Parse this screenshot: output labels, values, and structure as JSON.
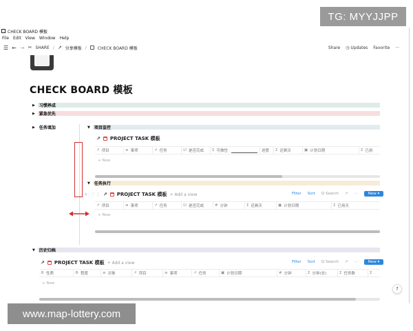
{
  "watermarks": {
    "tg": "TG: MYYJJPP",
    "url": "www.map-lottery.com"
  },
  "window": {
    "title": "CHECK BOARD 模板"
  },
  "menu": [
    "File",
    "Edit",
    "View",
    "Window",
    "Help"
  ],
  "breadcrumbs": [
    "SHARE",
    "分享模板",
    "CHECK BOARD 模板"
  ],
  "topbar": {
    "share": "Share",
    "updates": "Updates",
    "favorite": "Favorite",
    "more": "···"
  },
  "page": {
    "title": "CHECK BOARD 模板"
  },
  "toggles": [
    {
      "label": "习惯养成",
      "color": "#dfece6"
    },
    {
      "label": "紧急优先",
      "color": "#f7dede"
    },
    {
      "label": "任务填加"
    }
  ],
  "sections": {
    "monitor": {
      "label": "项目监控",
      "color": "#e3ebee"
    },
    "execute": {
      "label": "任务执行",
      "color": "#f6ecd9"
    },
    "history": {
      "label": "历史归档",
      "color": "#e7e6ef"
    }
  },
  "db1": {
    "title": "PROJECT TASK 模板",
    "columns": [
      {
        "glyph": "↗",
        "label": "项目"
      },
      {
        "glyph": "≡",
        "label": "事项"
      },
      {
        "glyph": "↗",
        "label": "任务"
      },
      {
        "glyph": "☑",
        "label": "是否完成"
      },
      {
        "glyph": "Σ",
        "label": "可做性"
      },
      {
        "glyph": "",
        "label": "进度"
      },
      {
        "glyph": "Σ",
        "label": "还剩天"
      },
      {
        "glyph": "▣",
        "label": "计划日期"
      },
      {
        "glyph": "Σ",
        "label": "已用"
      }
    ],
    "new_label": "+ New"
  },
  "db2": {
    "title": "PROJECT TASK 模板",
    "add_view": "+ Add a view",
    "tools": {
      "filter": "Filter",
      "sort": "Sort",
      "search": "Q Search",
      "expand": "↗",
      "more": "···",
      "new": "New ▾"
    },
    "columns": [
      {
        "glyph": "↗",
        "label": "项目"
      },
      {
        "glyph": "≡",
        "label": "事项"
      },
      {
        "glyph": "↗",
        "label": "任务"
      },
      {
        "glyph": "☑",
        "label": "是否完成"
      },
      {
        "glyph": "#",
        "label": "分钟"
      },
      {
        "glyph": "Σ",
        "label": "还剩天"
      },
      {
        "glyph": "▣",
        "label": "计划日期"
      },
      {
        "glyph": "Σ",
        "label": "已用天"
      }
    ],
    "new_label": "+ New"
  },
  "db3": {
    "title": "PROJECT TASK 模板",
    "add_view": "+ Add a view",
    "tools": {
      "filter": "Filter",
      "sort": "Sort",
      "search": "Q Search",
      "expand": "↗",
      "more": "···",
      "new": "New ▾"
    },
    "columns": [
      {
        "glyph": "⚙",
        "label": "性质"
      },
      {
        "glyph": "⚙",
        "label": "程度"
      },
      {
        "glyph": "≡",
        "label": "对象"
      },
      {
        "glyph": "↗",
        "label": "项目"
      },
      {
        "glyph": "≡",
        "label": "事项"
      },
      {
        "glyph": "↗",
        "label": "任务"
      },
      {
        "glyph": "▣",
        "label": "计划日期"
      },
      {
        "glyph": "#",
        "label": "分钟"
      },
      {
        "glyph": "Σ",
        "label": "分钟(总)"
      },
      {
        "glyph": "Σ",
        "label": "任务数"
      },
      {
        "glyph": "Σ",
        "label": ""
      }
    ],
    "new_label": "+ New"
  },
  "help": "?",
  "colors": {
    "accent": "#2e86de",
    "annotation": "#d03030"
  }
}
